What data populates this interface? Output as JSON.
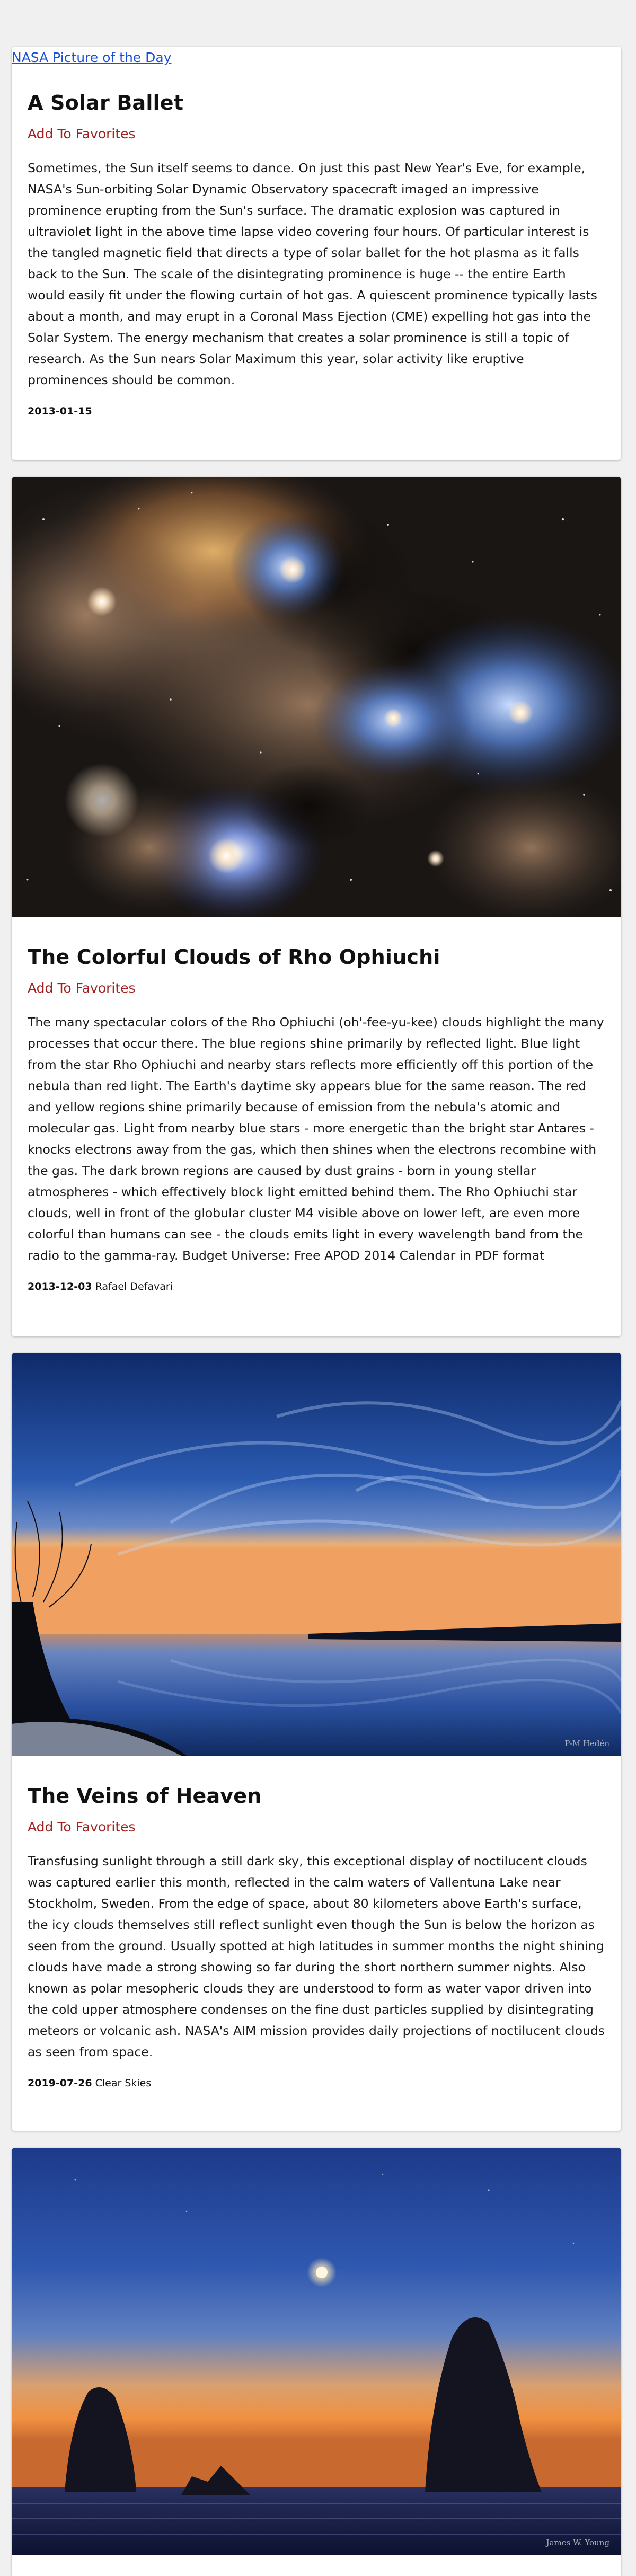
{
  "header": {
    "site_link": "NASA Picture of the Day"
  },
  "cards": [
    {
      "title": "A Solar Ballet",
      "favorite_label": "Add To Favorites",
      "description": "Sometimes, the Sun itself seems to dance. On just this past New Year's Eve, for example, NASA's Sun-orbiting Solar Dynamic Observatory spacecraft imaged an impressive prominence erupting from the Sun's surface. The dramatic explosion was captured in ultraviolet light in the above time lapse video covering four hours. Of particular interest is the tangled magnetic field that directs a type of solar ballet for the hot plasma as it falls back to the Sun. The scale of the disintegrating prominence is huge -- the entire Earth would easily fit under the flowing curtain of hot gas. A quiescent prominence typically lasts about a month, and may erupt in a Coronal Mass Ejection (CME) expelling hot gas into the Solar System. The energy mechanism that creates a solar prominence is still a topic of research. As the Sun nears Solar Maximum this year, solar activity like eruptive prominences should be common.",
      "date": "2013-01-15",
      "copyright": ""
    },
    {
      "title": "The Colorful Clouds of Rho Ophiuchi",
      "favorite_label": "Add To Favorites",
      "description": "The many spectacular colors of the Rho Ophiuchi (oh'-fee-yu-kee) clouds highlight the many processes that occur there. The blue regions shine primarily by reflected light. Blue light from the star Rho Ophiuchi and nearby stars reflects more efficiently off this portion of the nebula than red light. The Earth's daytime sky appears blue for the same reason. The red and yellow regions shine primarily because of emission from the nebula's atomic and molecular gas. Light from nearby blue stars - more energetic than the bright star Antares - knocks electrons away from the gas, which then shines when the electrons recombine with the gas. The dark brown regions are caused by dust grains - born in young stellar atmospheres - which effectively block light emitted behind them. The Rho Ophiuchi star clouds, well in front of the globular cluster M4 visible above on lower left, are even more colorful than humans can see - the clouds emits light in every wavelength band from the radio to the gamma-ray. Budget Universe: Free APOD 2014 Calendar in PDF format",
      "date": "2013-12-03",
      "copyright": "Rafael Defavari",
      "image_alt": "Rho Ophiuchi nebula"
    },
    {
      "title": "The Veins of Heaven",
      "favorite_label": "Add To Favorites",
      "description": "Transfusing sunlight through a still dark sky, this exceptional display of noctilucent clouds was captured earlier this month, reflected in the calm waters of Vallentuna Lake near Stockholm, Sweden. From the edge of space, about 80 kilometers above Earth's surface, the icy clouds themselves still reflect sunlight even though the Sun is below the horizon as seen from the ground. Usually spotted at high latitudes in summer months the night shining clouds have made a strong showing so far during the short northern summer nights. Also known as polar mesopheric clouds they are understood to form as water vapor driven into the cold upper atmosphere condenses on the fine dust particles supplied by disintegrating meteors or volcanic ash. NASA's AIM mission provides daily projections of noctilucent clouds as seen from space.",
      "date": "2019-07-26",
      "copyright": "Clear Skies",
      "image_credit": "P-M Hedén",
      "image_alt": "Noctilucent clouds over a lake"
    },
    {
      "image_credit": "James W. Young",
      "image_alt": "Sea stacks at dusk with crescent moon"
    }
  ]
}
